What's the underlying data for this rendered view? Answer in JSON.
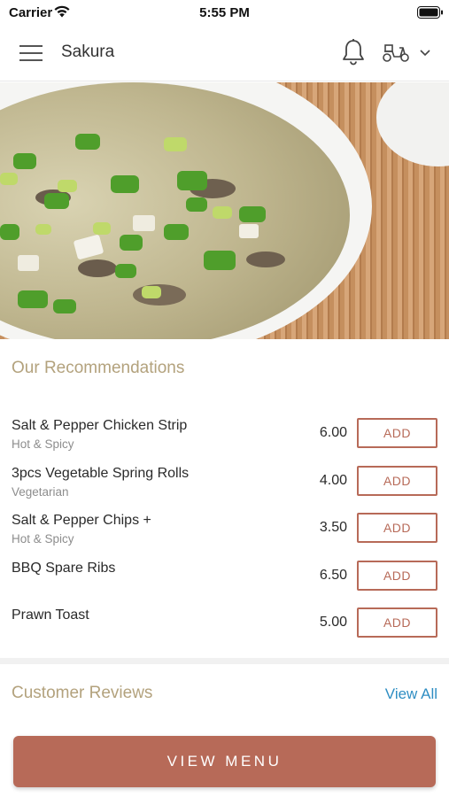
{
  "status_bar": {
    "carrier": "Carrier",
    "time": "5:55 PM"
  },
  "header": {
    "title": "Sakura",
    "icons": [
      "menu-icon",
      "bell-icon",
      "scooter-icon",
      "chevron-down-icon"
    ]
  },
  "hero": {
    "image": "hot-and-sour-soup-photo"
  },
  "recommendations": {
    "title": "Our Recommendations",
    "add_label": "ADD",
    "items": [
      {
        "name": "Salt & Pepper Chicken Strip",
        "tag": "Hot & Spicy",
        "price": "6.00"
      },
      {
        "name": "3pcs Vegetable Spring Rolls",
        "tag": "Vegetarian",
        "price": "4.00"
      },
      {
        "name": "Salt & Pepper Chips +",
        "tag": "Hot & Spicy",
        "price": "3.50"
      },
      {
        "name": "BBQ Spare Ribs",
        "tag": "",
        "price": "6.50"
      },
      {
        "name": "Prawn Toast",
        "tag": "",
        "price": "5.00"
      }
    ]
  },
  "reviews": {
    "title": "Customer Reviews",
    "view_all": "View All"
  },
  "footer": {
    "view_menu": "VIEW MENU"
  },
  "colors": {
    "accent": "#b76a58",
    "section_title": "#b3a27d",
    "link": "#2f8ec3"
  }
}
